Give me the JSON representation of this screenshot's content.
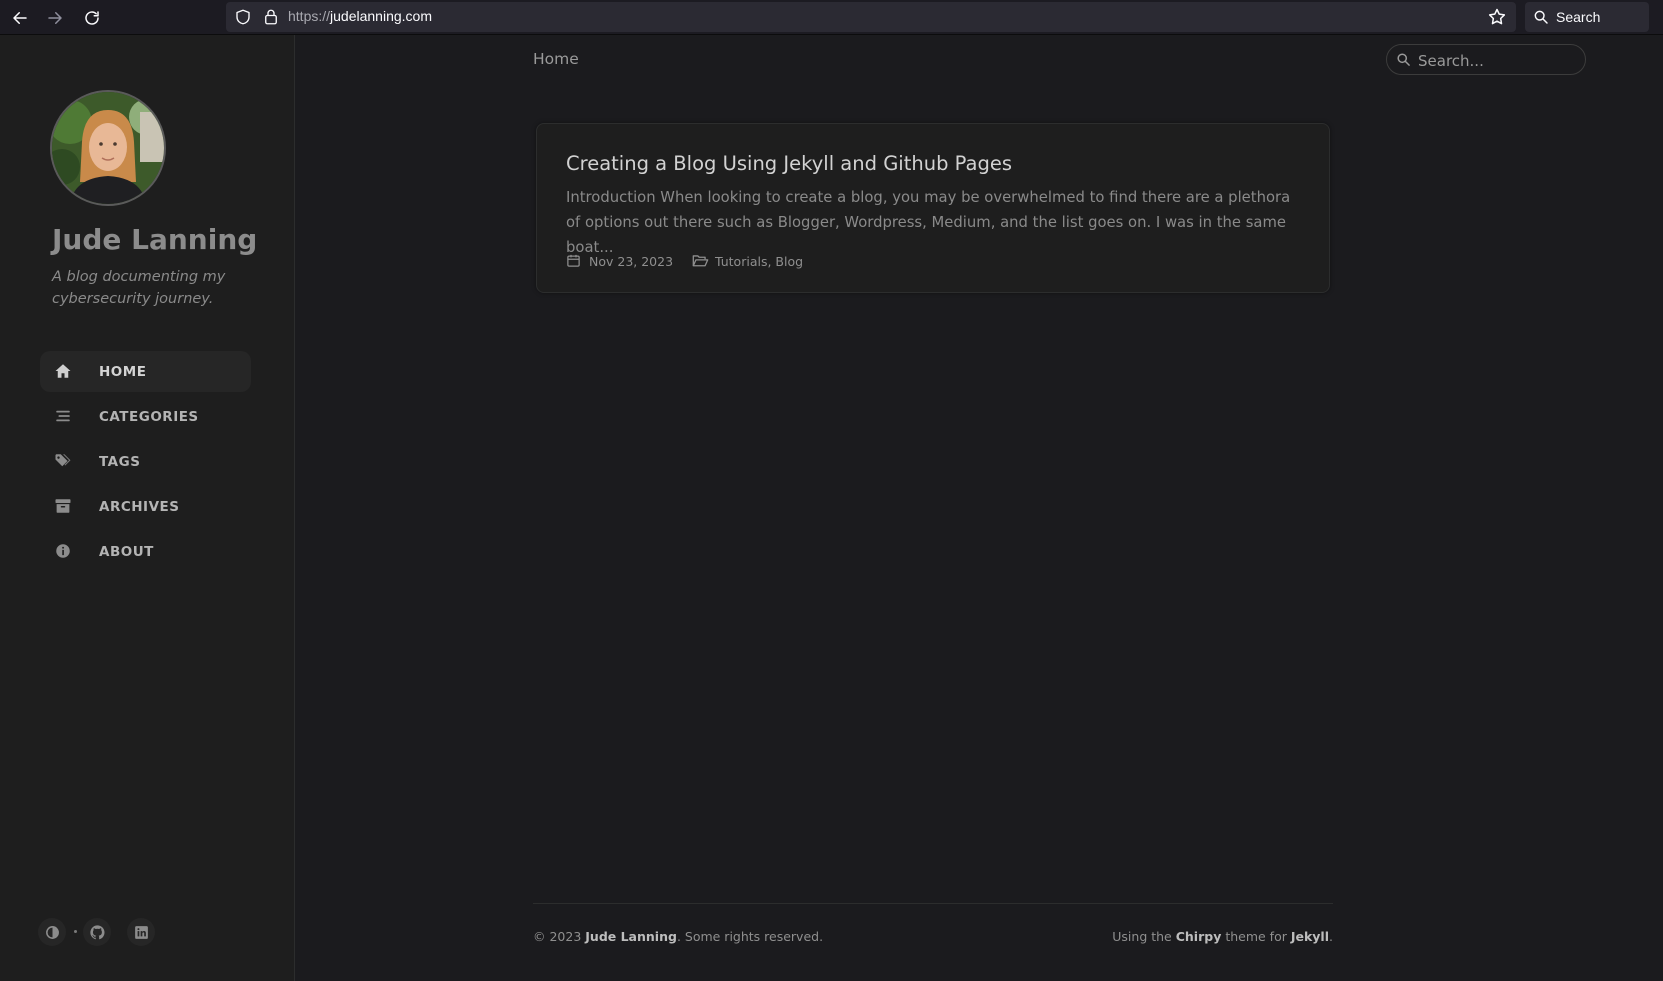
{
  "browser": {
    "url_scheme": "https://",
    "url_host": "judelanning.com",
    "search_label": "Search"
  },
  "sidebar": {
    "site_title": "Jude Lanning",
    "site_subtitle": "A blog documenting my cybersecurity journey.",
    "items": [
      {
        "label": "HOME",
        "icon": "home-icon",
        "active": true
      },
      {
        "label": "CATEGORIES",
        "icon": "stream-icon",
        "active": false
      },
      {
        "label": "TAGS",
        "icon": "tags-icon",
        "active": false
      },
      {
        "label": "ARCHIVES",
        "icon": "archive-icon",
        "active": false
      },
      {
        "label": "ABOUT",
        "icon": "info-circle-icon",
        "active": false
      }
    ],
    "bottom_icons": [
      "theme-toggle-icon",
      "github-icon",
      "linkedin-icon"
    ]
  },
  "topbar": {
    "breadcrumb": "Home",
    "search_placeholder": "Search..."
  },
  "posts": [
    {
      "title": "Creating a Blog Using Jekyll and Github Pages",
      "excerpt": "Introduction When looking to create a blog, you may be overwhelmed to find there are a plethora of options out there such as Blogger, Wordpress, Medium, and the list goes on. I was in the same boat...",
      "date": "Nov 23, 2023",
      "categories": "Tutorials, Blog"
    }
  ],
  "footer": {
    "copyright_prefix": "© 2023 ",
    "author": "Jude Lanning",
    "rights": ". Some rights reserved.",
    "using_prefix": "Using the ",
    "theme": "Chirpy",
    "theme_middle": " theme for ",
    "engine": "Jekyll",
    "suffix": "."
  },
  "colors": {
    "background": "#1b1b1e",
    "sidebar": "#1e1e1e",
    "card": "#1e1e1e"
  }
}
